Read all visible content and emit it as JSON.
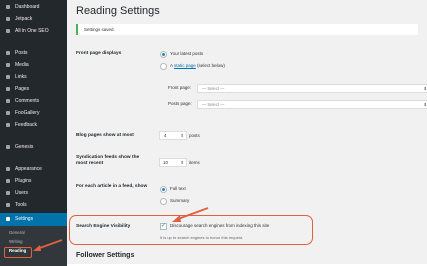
{
  "sidebar": {
    "items": [
      {
        "label": "Dashboard",
        "icon": "dashboard-icon"
      },
      {
        "label": "Jetpack",
        "icon": "jetpack-icon"
      },
      {
        "label": "All in One SEO",
        "icon": "seo-icon"
      },
      {
        "label": "Posts",
        "icon": "posts-icon"
      },
      {
        "label": "Media",
        "icon": "media-icon"
      },
      {
        "label": "Links",
        "icon": "links-icon"
      },
      {
        "label": "Pages",
        "icon": "pages-icon"
      },
      {
        "label": "Comments",
        "icon": "comments-icon"
      },
      {
        "label": "FooGallery",
        "icon": "gallery-icon"
      },
      {
        "label": "Feedback",
        "icon": "feedback-icon"
      },
      {
        "label": "Genesis",
        "icon": "genesis-icon"
      },
      {
        "label": "Appearance",
        "icon": "appearance-icon"
      },
      {
        "label": "Plugins",
        "icon": "plugins-icon"
      },
      {
        "label": "Users",
        "icon": "users-icon"
      },
      {
        "label": "Tools",
        "icon": "tools-icon"
      },
      {
        "label": "Settings",
        "icon": "settings-icon"
      }
    ],
    "subitems": [
      "General",
      "Writing",
      "Reading"
    ]
  },
  "page": {
    "title": "Reading Settings",
    "notice": "Settings saved."
  },
  "front_page": {
    "label": "Front page displays",
    "option_latest": "Your latest posts",
    "option_static_pre": "A",
    "option_static_link": "static page",
    "option_static_post": "(select below)",
    "front_label": "Front page:",
    "front_value": "— Select —",
    "posts_label": "Posts page:",
    "posts_value": "— Select —"
  },
  "blog_pages": {
    "label": "Blog pages show at most",
    "value": "4",
    "unit": "posts"
  },
  "syndication": {
    "label": "Syndication feeds show the most recent",
    "value": "10",
    "unit": "items"
  },
  "feed_article": {
    "label": "For each article in a feed, show",
    "option_full": "Full text",
    "option_summary": "Summary"
  },
  "search_visibility": {
    "label": "Search Engine Visibility",
    "checkbox_label": "Discourage search engines from indexing this site",
    "note": "It is up to search engines to honor this request."
  },
  "follower": {
    "title": "Follower Settings"
  },
  "colors": {
    "sidebar_bg": "#23282d",
    "active": "#0073aa",
    "highlight": "#e06040"
  }
}
